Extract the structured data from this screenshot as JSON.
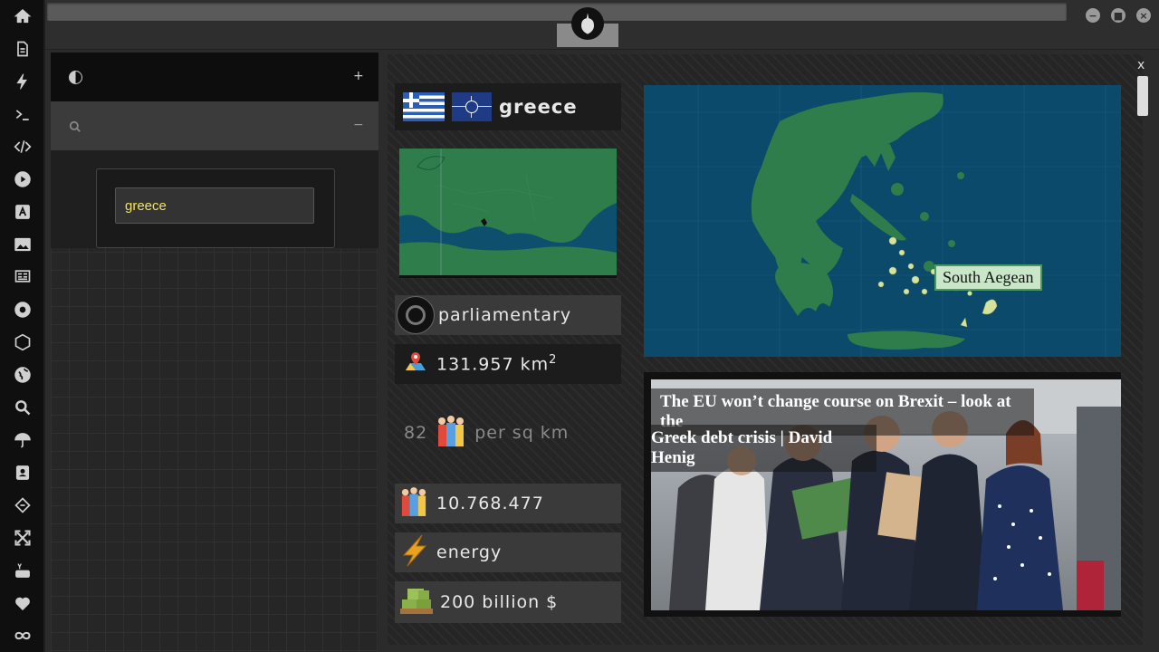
{
  "sidebar": {
    "items": [
      {
        "icon": "home-icon"
      },
      {
        "icon": "document-icon"
      },
      {
        "icon": "lightning-icon"
      },
      {
        "icon": "terminal-icon"
      },
      {
        "icon": "code-icon"
      },
      {
        "icon": "play-icon"
      },
      {
        "icon": "translate-icon"
      },
      {
        "icon": "image-icon"
      },
      {
        "icon": "news-icon"
      },
      {
        "icon": "empire-icon"
      },
      {
        "icon": "hexagon-icon"
      },
      {
        "icon": "globe-icon"
      },
      {
        "icon": "search-icon"
      },
      {
        "icon": "umbrella-icon"
      },
      {
        "icon": "contacts-icon"
      },
      {
        "icon": "diamond-code-icon"
      },
      {
        "icon": "expand-icon"
      },
      {
        "icon": "youtube-icon"
      },
      {
        "icon": "heart-icon"
      },
      {
        "icon": "infinity-icon"
      }
    ]
  },
  "left_panel": {
    "search": {
      "value": "greece"
    },
    "header1_button": "+",
    "header2_button": "−"
  },
  "country": {
    "name": "greece",
    "government": "parliamentary",
    "area": "131.957 km",
    "area_exp": "2",
    "density_value": "82",
    "density_unit": "per sq km",
    "population": "10.768.477",
    "category": "energy",
    "gdp": "200 billion $"
  },
  "region_map": {
    "tooltip": "South Aegean"
  },
  "news": {
    "headline_line1": "The EU won’t change course on Brexit – look at the",
    "headline_line2": "Greek debt crisis | David Henig"
  },
  "window": {
    "close_label": "x"
  },
  "colors": {
    "sea": "#0b4a6b",
    "land": "#2e7d4a",
    "highlight": "#d6e39a",
    "search_text": "#f2e35d"
  }
}
